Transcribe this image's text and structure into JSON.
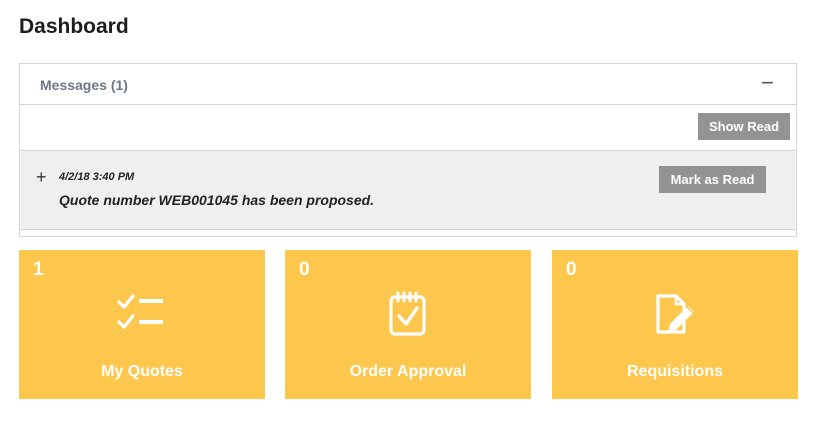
{
  "page": {
    "title": "Dashboard"
  },
  "messages": {
    "header": "Messages (1)",
    "collapse_symbol": "−",
    "show_read_label": "Show Read",
    "items": [
      {
        "expand_symbol": "+",
        "timestamp": "4/2/18 3:40 PM",
        "text": "Quote number WEB001045 has been proposed.",
        "mark_read_label": "Mark as Read"
      }
    ]
  },
  "tiles": [
    {
      "count": "1",
      "label": "My Quotes",
      "icon": "checklist-icon"
    },
    {
      "count": "0",
      "label": "Order Approval",
      "icon": "clipboard-check-icon"
    },
    {
      "count": "0",
      "label": "Requisitions",
      "icon": "document-edit-icon"
    }
  ],
  "colors": {
    "tile_background": "#fdc74e",
    "button_gray": "#939393",
    "message_background": "#efefef",
    "header_text": "#6e7788"
  }
}
